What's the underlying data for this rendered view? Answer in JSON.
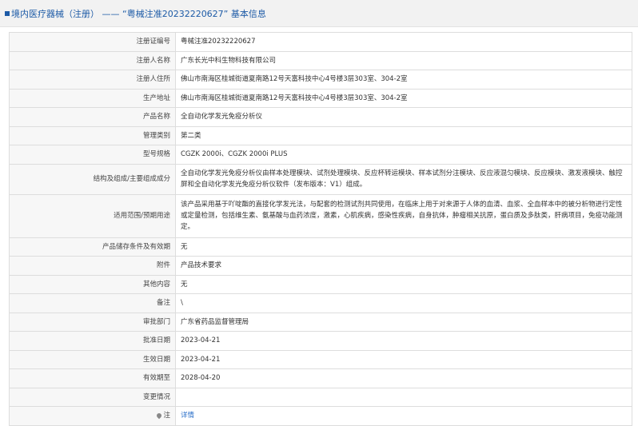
{
  "header": {
    "part1": "境内医疗器械（注册）",
    "sep": "——",
    "part2": "“粤械注准20232220627”",
    "part3": "基本信息"
  },
  "rows": [
    {
      "label": "注册证编号",
      "value": "粤械注准20232220627"
    },
    {
      "label": "注册人名称",
      "value": "广东长光中科生物科技有限公司"
    },
    {
      "label": "注册人住所",
      "value": "佛山市南海区桂城街道夏南路12号天富科技中心4号楼3层303室、304-2室"
    },
    {
      "label": "生产地址",
      "value": "佛山市南海区桂城街道夏南路12号天富科技中心4号楼3层303室、304-2室"
    },
    {
      "label": "产品名称",
      "value": "全自动化学发光免疫分析仪"
    },
    {
      "label": "管理类别",
      "value": "第二类"
    },
    {
      "label": "型号规格",
      "value": "CGZK 2000i、CGZK 2000i PLUS"
    },
    {
      "label": "结构及组成/主要组成成分",
      "value": "全自动化学发光免疫分析仪由样本处理模块、试剂处理模块、反应杯转运模块、样本试剂分注模块、反应液混匀模块、反应模块、激发液模块、触控屏和全自动化学发光免疫分析仪软件（发布版本：V1）组成。"
    },
    {
      "label": "适用范围/预期用途",
      "value": "该产品采用基于吖啶酯的直接化学发光法，与配套的检测试剂共同使用，在临床上用于对来源于人体的血清、血浆、全血样本中的被分析物进行定性或定量检测，包括维生素、氨基酸与血药浓度，激素，心肌疾病，感染性疾病，自身抗体，肿瘤相关抗原，蛋白质及多肽类，肝病项目，免疫功能测定。"
    },
    {
      "label": "产品储存条件及有效期",
      "value": "无"
    },
    {
      "label": "附件",
      "value": "产品技术要求"
    },
    {
      "label": "其他内容",
      "value": "无"
    },
    {
      "label": "备注",
      "value": "\\"
    },
    {
      "label": "审批部门",
      "value": "广东省药品监督管理局"
    },
    {
      "label": "批准日期",
      "value": "2023-04-21"
    },
    {
      "label": "生效日期",
      "value": "2023-04-21"
    },
    {
      "label": "有效期至",
      "value": "2028-04-20"
    },
    {
      "label": "变更情况",
      "value": ""
    }
  ],
  "note": {
    "label": "注",
    "link": "详情"
  }
}
